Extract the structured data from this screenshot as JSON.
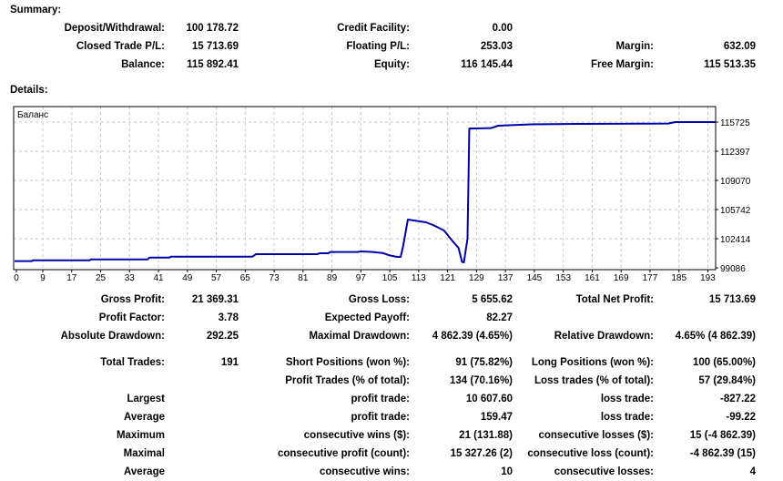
{
  "summary": {
    "title": "Summary:",
    "rows": [
      [
        [
          "Deposit/Withdrawal:",
          "100 178.72"
        ],
        [
          "Credit Facility:",
          "0.00"
        ],
        [
          "",
          ""
        ]
      ],
      [
        [
          "Closed Trade P/L:",
          "15 713.69"
        ],
        [
          "Floating P/L:",
          "253.03"
        ],
        [
          "Margin:",
          "632.09"
        ]
      ],
      [
        [
          "Balance:",
          "115 892.41"
        ],
        [
          "Equity:",
          "116 145.44"
        ],
        [
          "Free Margin:",
          "115 513.35"
        ]
      ]
    ]
  },
  "details": {
    "title": "Details:",
    "rows": [
      [
        [
          "Gross Profit:",
          "21 369.31"
        ],
        [
          "Gross Loss:",
          "5 655.62"
        ],
        [
          "Total Net Profit:",
          "15 713.69"
        ]
      ],
      [
        [
          "Profit Factor:",
          "3.78"
        ],
        [
          "Expected Payoff:",
          "82.27"
        ],
        [
          "",
          ""
        ]
      ],
      [
        [
          "Absolute Drawdown:",
          "292.25"
        ],
        [
          "Maximal Drawdown:",
          "4 862.39 (4.65%)"
        ],
        [
          "Relative Drawdown:",
          "4.65% (4 862.39)"
        ]
      ],
      [
        [
          "Total Trades:",
          "191"
        ],
        [
          "Short Positions (won %):",
          "91 (75.82%)"
        ],
        [
          "Long Positions (won %):",
          "100 (65.00%)"
        ]
      ],
      [
        [
          "",
          ""
        ],
        [
          "Profit Trades (% of total):",
          "134 (70.16%)"
        ],
        [
          "Loss trades (% of total):",
          "57 (29.84%)"
        ]
      ],
      [
        [
          "Largest",
          ""
        ],
        [
          "profit trade:",
          "10 607.60"
        ],
        [
          "loss trade:",
          "-827.22"
        ]
      ],
      [
        [
          "Average",
          ""
        ],
        [
          "profit trade:",
          "159.47"
        ],
        [
          "loss trade:",
          "-99.22"
        ]
      ],
      [
        [
          "Maximum",
          ""
        ],
        [
          "consecutive wins ($):",
          "21 (131.88)"
        ],
        [
          "consecutive losses ($):",
          "15 (-4 862.39)"
        ]
      ],
      [
        [
          "Maximal",
          ""
        ],
        [
          "consecutive profit (count):",
          "15 327.26 (2)"
        ],
        [
          "consecutive loss (count):",
          "-4 862.39 (15)"
        ]
      ],
      [
        [
          "Average",
          ""
        ],
        [
          "consecutive wins:",
          "10"
        ],
        [
          "consecutive losses:",
          "4"
        ]
      ]
    ]
  },
  "chart_data": {
    "type": "line",
    "title": "Баланс",
    "xlabel": "",
    "ylabel": "",
    "x_ticks": [
      0,
      9,
      17,
      25,
      33,
      41,
      49,
      57,
      65,
      73,
      81,
      89,
      97,
      105,
      113,
      121,
      129,
      137,
      145,
      153,
      161,
      169,
      177,
      185,
      193
    ],
    "y_ticks": [
      99086,
      102414,
      105742,
      109070,
      112397,
      115725
    ],
    "ylim": [
      99086,
      115725
    ],
    "grid": true,
    "line_color": "#0000AA",
    "series": [
      {
        "name": "Баланс",
        "x": [
          1,
          6,
          6.3,
          22,
          22.3,
          38,
          38.5,
          44,
          44.5,
          67,
          68,
          85,
          85.5,
          88,
          88.5,
          96,
          97,
          100,
          103,
          105,
          107,
          108,
          108.7,
          110,
          111,
          115,
          117,
          120,
          122,
          124,
          125,
          125.5,
          126.5,
          126.8,
          127,
          133,
          135,
          144,
          157,
          182,
          184,
          195
        ],
        "y": [
          99850,
          99850,
          99950,
          99950,
          100050,
          100050,
          100260,
          100260,
          100365,
          100365,
          100650,
          100650,
          100750,
          100750,
          100890,
          100890,
          100960,
          100900,
          100780,
          100500,
          100330,
          100330,
          101580,
          104600,
          104530,
          104286,
          103970,
          103350,
          102310,
          101370,
          99760,
          99710,
          102414,
          109900,
          114990,
          115030,
          115310,
          115470,
          115520,
          115560,
          115725,
          115725
        ]
      }
    ]
  }
}
